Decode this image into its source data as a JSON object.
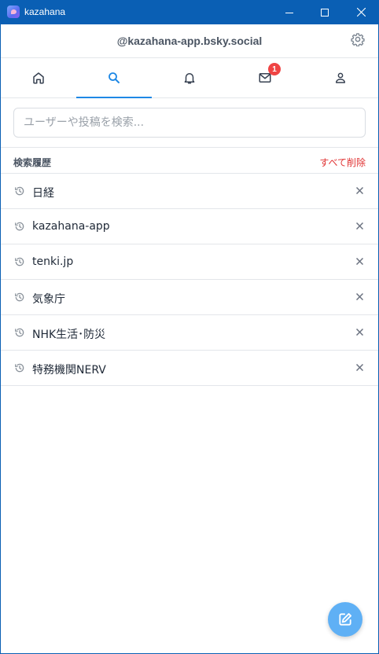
{
  "window": {
    "title": "kazahana"
  },
  "header": {
    "handle": "@kazahana-app.bsky.social"
  },
  "tabs": [
    {
      "name": "home",
      "icon": "home-icon",
      "active": false
    },
    {
      "name": "search",
      "icon": "search-icon",
      "active": true
    },
    {
      "name": "notifications",
      "icon": "bell-icon",
      "active": false
    },
    {
      "name": "messages",
      "icon": "mail-icon",
      "active": false,
      "badge": "1"
    },
    {
      "name": "profile",
      "icon": "person-icon",
      "active": false
    }
  ],
  "search": {
    "placeholder": "ユーザーや投稿を検索...",
    "value": ""
  },
  "history": {
    "title": "検索履歴",
    "clear_all": "すべて削除",
    "items": [
      {
        "label": "日経"
      },
      {
        "label": "kazahana-app"
      },
      {
        "label": "tenki.jp"
      },
      {
        "label": "気象庁"
      },
      {
        "label": "NHK生活･防災"
      },
      {
        "label": "特務機関NERV"
      }
    ]
  },
  "colors": {
    "titlebar": "#0a5fb4",
    "accent": "#1e88e5",
    "danger": "#e03131",
    "fab": "#5fb0f5"
  }
}
